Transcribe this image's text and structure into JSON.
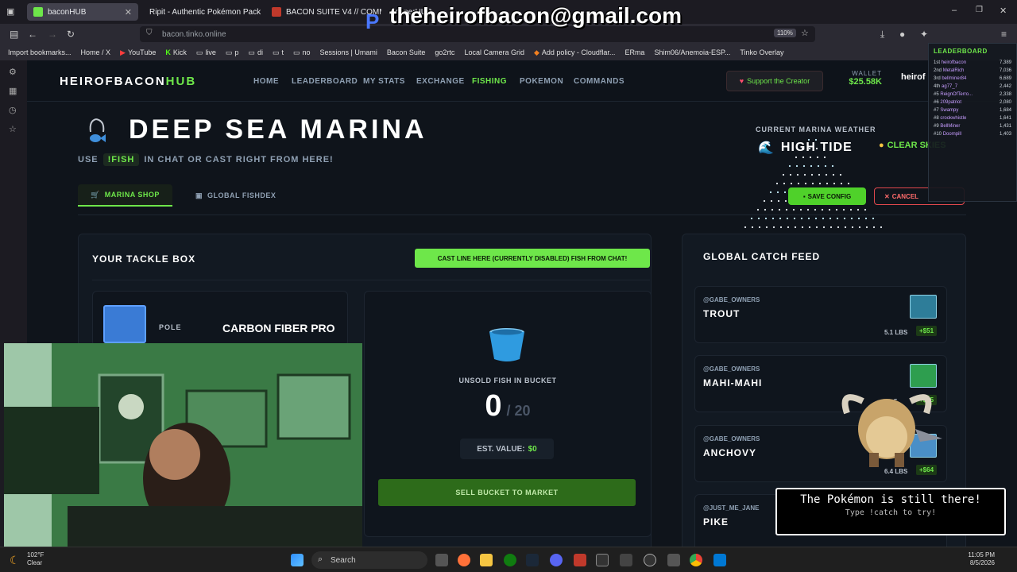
{
  "browser": {
    "tabs": [
      {
        "label": "baconHUB",
        "active": true
      },
      {
        "label": "Ripit - Authentic Pokémon Pack Op"
      },
      {
        "label": "BACON SUITE V4 // COMMAND"
      },
      {
        "label": "connerHUB"
      }
    ],
    "url": "bacon.tinko.online",
    "zoom": "110%",
    "bookmarks": [
      "Import bookmarks...",
      "Home / X",
      "YouTube",
      "Kick",
      "live",
      "p",
      "di",
      "t",
      "no",
      "Sessions | Umami",
      "Bacon Suite",
      "go2rtc",
      "Local Camera Grid",
      "Add policy - Cloudflar...",
      "ERma",
      "Shim06/Anemoia-ESP...",
      "Tinko Overlay"
    ]
  },
  "overlay": {
    "email": "theheirofbacon@gmail.com",
    "leaderboard": {
      "title": "LEADERBOARD",
      "rows": [
        {
          "rank": "1st",
          "name": "heirofbacon",
          "score": "7,389"
        },
        {
          "rank": "2nd",
          "name": "MetalRich",
          "score": "7,036"
        },
        {
          "rank": "3rd",
          "name": "bellminer84",
          "score": "6,689"
        },
        {
          "rank": "4th",
          "name": "ag77_7",
          "score": "2,442"
        },
        {
          "rank": "#5",
          "name": "ReignOfTerro...",
          "score": "2,338"
        },
        {
          "rank": "#6",
          "name": "209patriot",
          "score": "2,080"
        },
        {
          "rank": "#7",
          "name": "Swampy",
          "score": "1,684"
        },
        {
          "rank": "#8",
          "name": "crookwhistle",
          "score": "1,641"
        },
        {
          "rank": "#9",
          "name": "BellMiner",
          "score": "1,431"
        },
        {
          "rank": "#10",
          "name": "Doompill",
          "score": "1,403"
        }
      ]
    },
    "pokemon_message": {
      "line1": "The Pokémon is still there!",
      "line2": "Type !catch to try!"
    }
  },
  "site": {
    "logo_main": "HEIROFBACON",
    "logo_accent": "HUB",
    "nav": [
      "HOME",
      "LEADERBOARD",
      "MY STATS",
      "EXCHANGE",
      "FISHING",
      "POKEMON",
      "COMMANDS"
    ],
    "active_nav": "FISHING",
    "support": "Support the Creator",
    "wallet_label": "WALLET",
    "wallet_value": "$25.58K",
    "user": "heirof"
  },
  "marina": {
    "title": "DEEP SEA MARINA",
    "subtitle_pre": "USE",
    "subtitle_cmd": "!FISH",
    "subtitle_post": "IN CHAT OR CAST RIGHT FROM HERE!",
    "tabs": [
      {
        "label": "MARINA SHOP",
        "active": true
      },
      {
        "label": "GLOBAL FISHDEX"
      }
    ],
    "weather_label": "CURRENT MARINA WEATHER",
    "weather_main": "HIGH TIDE",
    "weather_sub": "CLEAR SKIES",
    "save_config": "SAVE CONFIG",
    "cancel": "CANCEL"
  },
  "tackle": {
    "title": "YOUR TACKLE BOX",
    "cast_button": "CAST LINE HERE (CURRENTLY DISABLED) FISH FROM CHAT!",
    "pole_label": "POLE",
    "pole_value": "CARBON FIBER PRO",
    "unsold_label": "UNSOLD FISH IN BUCKET",
    "count": "0",
    "capacity": "/ 20",
    "est_label": "EST. VALUE:",
    "est_value": "$0",
    "sell_button": "SELL BUCKET TO MARKET"
  },
  "feed": {
    "title": "GLOBAL CATCH FEED",
    "items": [
      {
        "user": "@GABE_OWNERS",
        "fish": "TROUT",
        "weight": "5.1 LBS",
        "price": "+$51"
      },
      {
        "user": "@GABE_OWNERS",
        "fish": "MAHI-MAHI",
        "weight": "5",
        "price": "+$35"
      },
      {
        "user": "@GABE_OWNERS",
        "fish": "ANCHOVY",
        "weight": "6.4 LBS",
        "price": "+$64"
      },
      {
        "user": "@JUST_ME_JANE",
        "fish": "PIKE",
        "weight": "",
        "price": ""
      }
    ]
  },
  "taskbar": {
    "search": "Search",
    "temp": "102°F",
    "cond": "Clear",
    "time": "11:05 PM",
    "date": "8/5/2026"
  },
  "colors": {
    "accent": "#6ee74a",
    "bg": "#0f141b",
    "panel": "#121922"
  }
}
